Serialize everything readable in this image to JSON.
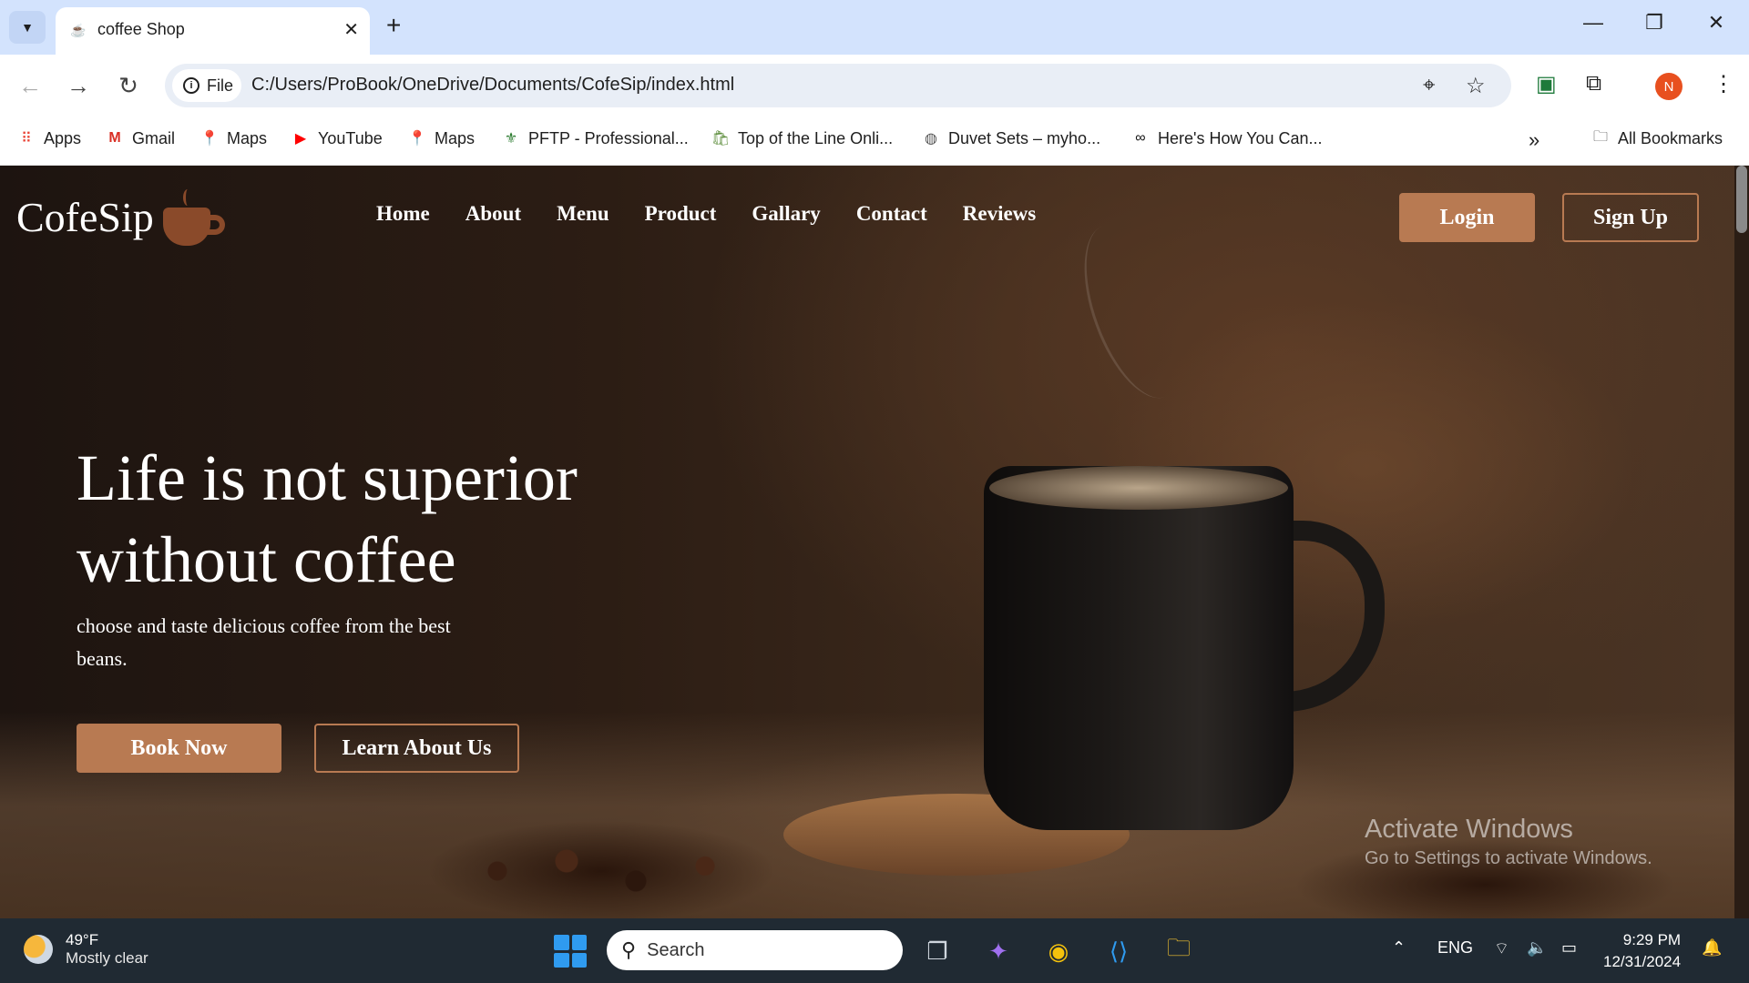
{
  "browser": {
    "tab_title": "coffee Shop",
    "url": "C:/Users/ProBook/OneDrive/Documents/CofeSip/index.html",
    "site_chip_label": "File",
    "avatar_initial": "N",
    "bookmarks": [
      {
        "label": "Apps",
        "icon": "apps-grid-icon"
      },
      {
        "label": "Gmail",
        "icon": "gmail-icon"
      },
      {
        "label": "Maps",
        "icon": "maps-pin-icon"
      },
      {
        "label": "YouTube",
        "icon": "youtube-icon"
      },
      {
        "label": "Maps",
        "icon": "maps-pin-icon"
      },
      {
        "label": "PFTP - Professional...",
        "icon": "pftp-icon"
      },
      {
        "label": "Top of the Line Onli...",
        "icon": "shopify-icon"
      },
      {
        "label": "Duvet Sets – myho...",
        "icon": "globe-icon"
      },
      {
        "label": "Here's How You Can...",
        "icon": "link-icon"
      }
    ],
    "all_bookmarks": "All Bookmarks"
  },
  "site": {
    "logo": "CofeSip",
    "nav": [
      "Home",
      "About",
      "Menu",
      "Product",
      "Gallary",
      "Contact",
      "Reviews"
    ],
    "login": "Login",
    "signup": "Sign Up",
    "hero_title": "Life is not superior without coffee",
    "hero_subtitle": "choose and taste delicious coffee from the best beans.",
    "book_now": "Book Now",
    "learn_about": "Learn About Us",
    "accent_color": "#b87a52"
  },
  "watermark": {
    "line1": "Activate Windows",
    "line2": "Go to Settings to activate Windows."
  },
  "taskbar": {
    "temperature": "49°F",
    "condition": "Mostly clear",
    "search_placeholder": "Search",
    "language": "ENG",
    "time": "9:29 PM",
    "date": "12/31/2024"
  }
}
